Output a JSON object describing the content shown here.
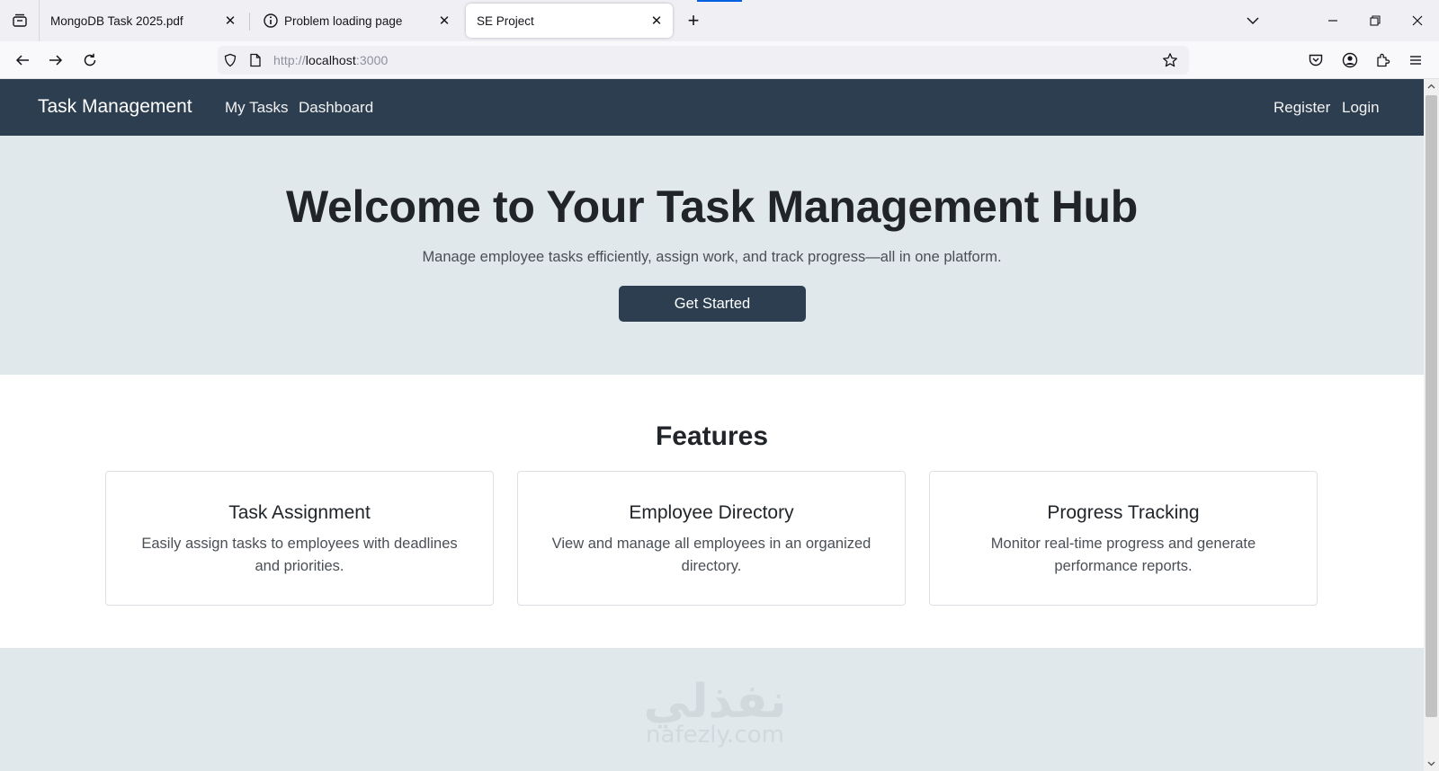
{
  "browser": {
    "tabs": [
      {
        "title": "MongoDB Task 2025.pdf",
        "icon": "none",
        "active": false
      },
      {
        "title": "Problem loading page",
        "icon": "info-icon",
        "active": false
      },
      {
        "title": "SE Project",
        "icon": "none",
        "active": true
      }
    ],
    "tab_close_glyph": "✕",
    "new_tab_glyph": "+",
    "url": {
      "prefix": "http://",
      "host": "localhost",
      "port": ":3000"
    },
    "window_controls": {
      "minimize": "—",
      "restore": "❐",
      "close": "✕"
    }
  },
  "site": {
    "brand": "Task Management",
    "nav_left": [
      "My Tasks",
      "Dashboard"
    ],
    "nav_right": [
      "Register",
      "Login"
    ],
    "colors": {
      "navbar": "#2c3e50",
      "hero_bg": "#e0e8ec",
      "button": "#2c3e50"
    }
  },
  "hero": {
    "title": "Welcome to Your Task Management Hub",
    "subtitle": "Manage employee tasks efficiently, assign work, and track progress—all in one platform.",
    "cta": "Get Started"
  },
  "features": {
    "heading": "Features",
    "cards": [
      {
        "title": "Task Assignment",
        "text": "Easily assign tasks to employees with deadlines and priorities."
      },
      {
        "title": "Employee Directory",
        "text": "View and manage all employees in an organized directory."
      },
      {
        "title": "Progress Tracking",
        "text": "Monitor real-time progress and generate performance reports."
      }
    ]
  },
  "watermark": {
    "arabic": "نفذلي",
    "latin": "nafezly.com"
  }
}
